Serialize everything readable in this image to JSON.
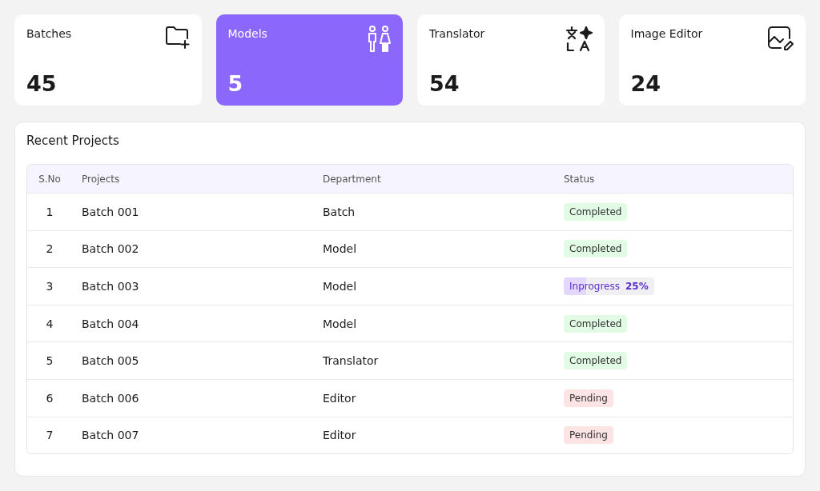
{
  "cards": [
    {
      "label": "Batches",
      "value": "45",
      "kind": "folder",
      "selected": false
    },
    {
      "label": "Models",
      "value": "5",
      "kind": "people",
      "selected": true
    },
    {
      "label": "Translator",
      "value": "54",
      "kind": "translate",
      "selected": false
    },
    {
      "label": "Image Editor",
      "value": "24",
      "kind": "image",
      "selected": false
    }
  ],
  "recent_projects": {
    "title": "Recent Projects",
    "columns": [
      "S.No",
      "Projects",
      "Department",
      "Status"
    ],
    "rows": [
      {
        "sno": "1",
        "project": "Batch 001",
        "department": "Batch",
        "status": {
          "kind": "completed",
          "label": "Completed"
        }
      },
      {
        "sno": "2",
        "project": "Batch 002",
        "department": "Model",
        "status": {
          "kind": "completed",
          "label": "Completed"
        }
      },
      {
        "sno": "3",
        "project": "Batch 003",
        "department": "Model",
        "status": {
          "kind": "inprogress",
          "label": "Inprogress",
          "percent": "25%",
          "level": 0.25
        }
      },
      {
        "sno": "4",
        "project": "Batch 004",
        "department": "Model",
        "status": {
          "kind": "completed",
          "label": "Completed"
        }
      },
      {
        "sno": "5",
        "project": "Batch 005",
        "department": "Translator",
        "status": {
          "kind": "completed",
          "label": "Completed"
        }
      },
      {
        "sno": "6",
        "project": "Batch 006",
        "department": "Editor",
        "status": {
          "kind": "pending",
          "label": "Pending"
        }
      },
      {
        "sno": "7",
        "project": "Batch 007",
        "department": "Editor",
        "status": {
          "kind": "pending",
          "label": "Pending"
        }
      }
    ]
  }
}
